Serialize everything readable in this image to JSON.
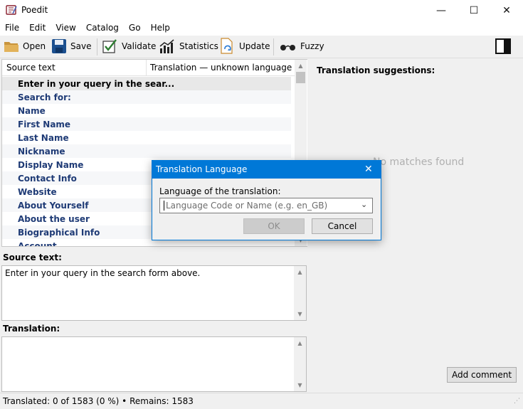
{
  "app": {
    "title": "Poedit"
  },
  "window_controls": {
    "minimize": "—",
    "maximize": "☐",
    "close": "✕"
  },
  "menu": [
    "File",
    "Edit",
    "View",
    "Catalog",
    "Go",
    "Help"
  ],
  "toolbar": {
    "open": "Open",
    "save": "Save",
    "validate": "Validate",
    "statistics": "Statistics",
    "update": "Update",
    "fuzzy": "Fuzzy"
  },
  "list": {
    "col_source": "Source text",
    "col_translation": "Translation — unknown language",
    "rows": [
      "Enter in your query in the sear...",
      "Search for:",
      "Name",
      "First Name",
      "Last Name",
      "Nickname",
      "Display Name",
      "Contact Info",
      "Website",
      "About Yourself",
      "About the user",
      "Biographical Info",
      "Account"
    ]
  },
  "source_panel": {
    "label": "Source text:",
    "text": "Enter in your query in the search form above."
  },
  "translation_panel": {
    "label": "Translation:",
    "text": ""
  },
  "suggestions": {
    "title": "Translation suggestions:",
    "empty": "No matches found",
    "add_comment": "Add comment"
  },
  "status": {
    "text": "Translated: 0 of 1583 (0 %)  •  Remains: 1583"
  },
  "dialog": {
    "title": "Translation Language",
    "close": "✕",
    "label": "Language of the translation:",
    "placeholder": "Language Code or Name (e.g. en_GB)",
    "ok": "OK",
    "cancel": "Cancel"
  },
  "colors": {
    "accent": "#0078d7",
    "row_text": "#1f3b76",
    "validate_green": "#2e7d32"
  }
}
